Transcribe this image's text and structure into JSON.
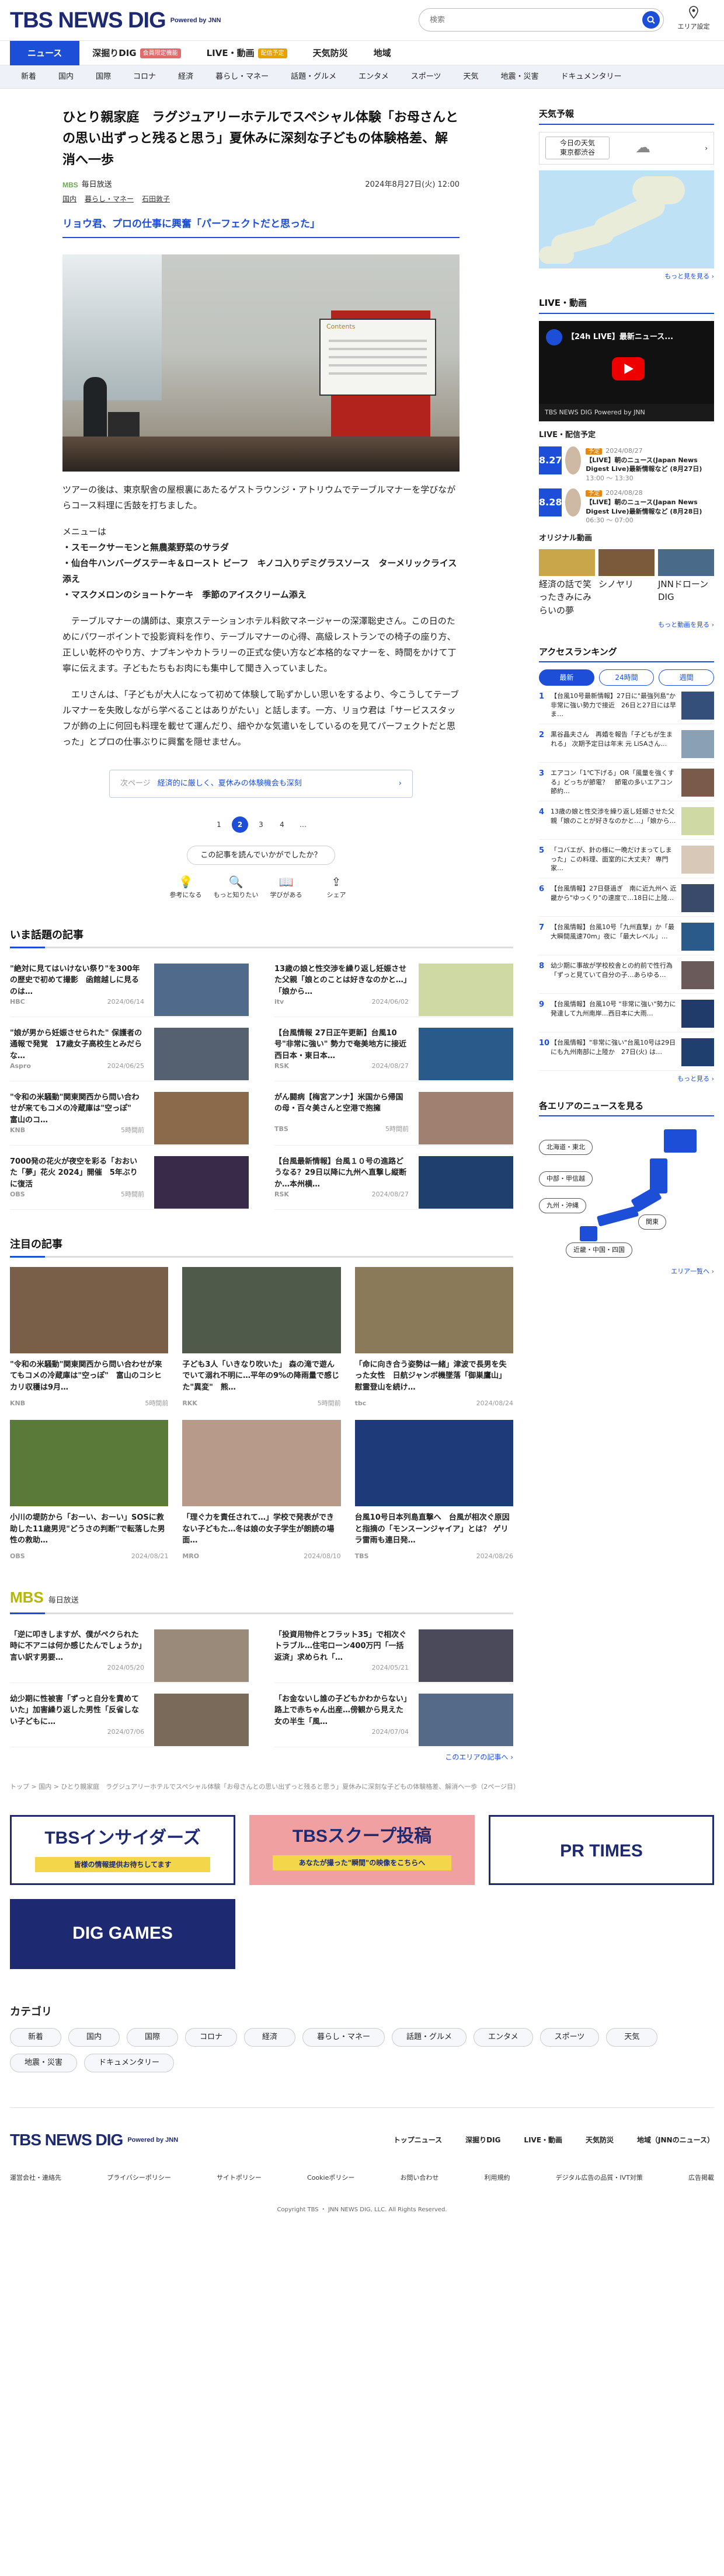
{
  "header": {
    "logo": "TBS NEWS DIG",
    "powered": "Powered by JNN",
    "search_placeholder": "検索",
    "area_setting": "エリア設定"
  },
  "nav_main": [
    {
      "label": "ニュース",
      "active": true
    },
    {
      "label": "深掘りDIG",
      "badge": "会員限定機能"
    },
    {
      "label": "LIVE・動画",
      "badge": "配信予定"
    },
    {
      "label": "天気防災"
    },
    {
      "label": "地域"
    }
  ],
  "nav_sub": [
    "新着",
    "国内",
    "国際",
    "コロナ",
    "経済",
    "暮らし・マネー",
    "話題・グルメ",
    "エンタメ",
    "スポーツ",
    "天気",
    "地震・災害",
    "ドキュメンタリー"
  ],
  "article": {
    "title": "ひとり親家庭　ラグジュアリーホテルでスペシャル体験「お母さんとの思い出ずっと残ると思う」夏休みに深刻な子どもの体験格差、解消へ一歩",
    "source": "毎日放送",
    "source_logo": "MBS",
    "date": "2024年8月27日(火) 12:00",
    "tags": [
      "国内",
      "暮らし・マネー",
      "石田敦子"
    ],
    "subheading": "リョウ君、プロの仕事に興奮「パーフェクトだと思った」",
    "slide_title": "Contents",
    "p1": "ツアーの後は、東京駅舎の屋根裏にあたるゲストラウンジ・アトリウムでテーブルマナーを学びながらコース料理に舌鼓を打ちました。",
    "menu_head": "メニューは",
    "menu": [
      "・スモークサーモンと無農薬野菜のサラダ",
      "・仙台牛ハンバーグステーキ＆ロースト ビーフ　キノコ入りデミグラスソース　ターメリックライス添え",
      "・マスクメロンのショートケーキ　季節のアイスクリーム添え"
    ],
    "p2": "　テーブルマナーの講師は、東京ステーションホテル料飲マネージャーの深澤聡史さん。この日のためにパワーポイントで投影資料を作り、テーブルマナーの心得、高級レストランでの椅子の座り方、正しい乾杯のやり方、ナプキンやカトラリーの正式な使い方など本格的なマナーを、時間をかけて丁寧に伝えます。子どもたちもお肉にも集中して聞き入っていました。",
    "p3": "　エリさんは、「子どもが大人になって初めて体験して恥ずかしい思いをするより、今こうしてテーブルマナーを失敗しながら学べることはありがたい」と話します。一方、リョウ君は「サービススタッフが飾の上に何回も料理を載せて運んだり、細やかな気遣いをしているのを見てパーフェクトだと思った」とプロの仕事ぶりに興奮を隠せません。",
    "related_label": "次ページ",
    "related_text": "経済的に厳しく、夏休みの体験機会も深刻",
    "pager": [
      "1",
      "2",
      "3",
      "4",
      "…"
    ],
    "pager_current": "2",
    "feedback_q": "この記事を読んでいかがでしたか？",
    "reactions": [
      "参考になる",
      "もっと知りたい",
      "学びがある",
      "シェア"
    ]
  },
  "hot": {
    "title": "いま話題の記事",
    "items": [
      {
        "text": "\"絶対に見てはいけない祭り\"を300年の歴史で初めて撮影　函館越しに見るのは…",
        "src": "HBC",
        "date": "2024/06/14",
        "c": "#4f6a8a"
      },
      {
        "text": "13歳の娘と性交渉を繰り返し妊娠させた父親「娘とのことは好きなのかと…」「娘から…",
        "src": "itv",
        "date": "2024/06/02",
        "c": "#cfd9a3"
      },
      {
        "text": "\"娘が男から妊娠させられた\" 保護者の通報で発覚　17歳女子高校生とみだらな…",
        "src": "Aspro",
        "date": "2024/06/25",
        "c": "#556070"
      },
      {
        "text": "【台風情報 27日正午更新】台風10号\"非常に強い\" 勢力で奄美地方に接近　西日本・東日本…",
        "src": "RSK",
        "date": "2024/08/27",
        "c": "#2a5a8a"
      },
      {
        "text": "\"令和の米騒動\"関東関西から問い合わせが来てもコメの冷蔵庫は\"空っぽ\"　富山のコ…",
        "src": "KNB",
        "date": "5時間前",
        "c": "#8a6a4a"
      },
      {
        "text": "がん闘病【梅宮アンナ】米国から帰国の母・百々美さんと空港で抱擁",
        "src": "TBS",
        "date": "5時間前",
        "c": "#a08070"
      },
      {
        "text": "7000発の花火が夜空を彩る「おおいた「夢」花火 2024」開催　5年ぶりに復活",
        "src": "OBS",
        "date": "5時間前",
        "c": "#3a2a4a"
      },
      {
        "text": "【台風最新情報】台風１０号の進路どうなる？29日以降に九州へ直撃し縦断か…本州横…",
        "src": "RSK",
        "date": "2024/08/27",
        "c": "#1f3f6f"
      }
    ]
  },
  "featured": {
    "title": "注目の記事",
    "items": [
      {
        "text": "\"令和の米騒動\"関東関西から問い合わせが来てもコメの冷蔵庫は\"空っぽ\"　富山のコシヒカリ収穫は9月…",
        "src": "KNB",
        "date": "5時間前",
        "c": "#7a5f48"
      },
      {
        "text": "子ども3人「いきなり吹いた」 森の滝で遊んでいて溺れ不明に…平年の9%の降雨量で感じた\"異変\"　熊…",
        "src": "RKK",
        "date": "5時間前",
        "c": "#505a4a"
      },
      {
        "text": "「命に向き合う姿勢は一緒」津波で長男を失った女性　日航ジャンボ機墜落「御巣鷹山」慰霊登山を続け…",
        "src": "tbc",
        "date": "2024/08/24",
        "c": "#8a7a5a"
      },
      {
        "text": "小川の堤防から「おーい、おーい」SOSに救助した11歳男児\"どうさの判断\"で転落した男性の救助…",
        "src": "OBS",
        "date": "2024/08/21",
        "c": "#5a7a3a"
      },
      {
        "text": "「理ぐ力を責任されて…」学校で発表ができない子どもた…冬は娘の女子学生が朗読の場面…",
        "src": "MRO",
        "date": "2024/08/10",
        "c": "#b79a8a"
      },
      {
        "text": "台風10号日本列島直撃へ　台風が相次ぐ原因と指摘の「モンスーンジャイア」とは？ ゲリラ雷雨も連日発…",
        "src": "TBS",
        "date": "2024/08/26",
        "c": "#1e3a78"
      }
    ]
  },
  "mbs": {
    "logo": "MBS",
    "label": "毎日放送",
    "items": [
      {
        "text": "「逆に叩きしますが、僕がペクられた時に不アニは何か感じたんでしょうか」言い訳す男要…",
        "date": "2024/05/20",
        "c": "#9a8a7a"
      },
      {
        "text": "「投資用物件とフラット35」で相次ぐトラブル…住宅ローン400万円「一括返済」求められ「…",
        "date": "2024/05/21",
        "c": "#4a4a5a"
      },
      {
        "text": "幼少期に性被害「ずっと自分を責めていた」加害繰り返した男性「反省しない子どもに…",
        "date": "2024/07/06",
        "c": "#7a6a5a"
      },
      {
        "text": "「お金ないし誰の子どもかわからない」路上で赤ちゃん出産…傍観から見えた女の半生「風…",
        "date": "2024/07/04",
        "c": "#556a88"
      }
    ],
    "more": "このエリアの記事へ ›"
  },
  "breadcrumb": "トップ > 国内 > ひとり親家庭　ラグジュアリーホテルでスペシャル体験「お母さんとの思い出ずっと残ると思う」夏休みに深刻な子どもの体験格差、解消へ一歩（2ページ目）",
  "side": {
    "weather_title": "天気予報",
    "weather_place": "今日の天気\n東京都渋谷",
    "weather_more": "もっと見を見る ›",
    "live_title": "LIVE・動画",
    "live_video": "【24h LIVE】最新ニュース...",
    "live_bar": "TBS NEWS DIG Powered by JNN",
    "live_sub": "LIVE・配信予定",
    "live_items": [
      {
        "badge": "予定",
        "day": "8.27",
        "sub": "火",
        "date": "2024/08/27",
        "text": "【LIVE】朝のニュース(Japan News Digest Live)最新情報など (8月27日)",
        "time": "13:00 ～ 13:30"
      },
      {
        "badge": "予定",
        "day": "8.28",
        "sub": "水",
        "date": "2024/08/28",
        "text": "【LIVE】朝のニュース(Japan News Digest Live)最新情報など (8月28日)",
        "time": "06:30 ～ 07:00"
      }
    ],
    "orig_title": "オリジナル動画",
    "origs": [
      "経済の話で笑ったきみにみらいの夢",
      "シノヤリ",
      "JNNドローンDIG"
    ],
    "orig_more": "もっと動画を見る ›",
    "rank_title": "アクセスランキング",
    "rank_tabs": [
      "最新",
      "24時間",
      "週間"
    ],
    "ranks": [
      "【台風10号最新情報】27日に\"最強列島\"か 非常に強い勢力で接近　26日と27日には早ま…",
      "黒谷晶夫さん　再婚を報告「子どもが生まれる」 次期予定日は年末 元 LiSAさん…",
      "エアコン「1℃下げる」OR「風量を強くする」どっちが節電？　節電の多いエアコン節約…",
      "13歳の娘と性交渉を繰り返し妊娠させた父親「娘のことが好きなのかと…」「娘から…",
      "「コバエが、針の様に一晩だけまってしまった」この料理、面室的に大丈夫？ 専門家…",
      "【台風情報】27日昼過ぎ　南に近九州へ 近畿から\"ゆっくり\"の速度で…18日に上陸…",
      "【台風情報】台風10号「九州直撃」か「最大瞬間風速70m」夜に「最大レベル」…",
      "幼少期に事故が学校校舎との約前で性行為「ずっと見ていて自分の子…あらゆる…",
      "【台風情報】台風10号 \"非常に強い\"勢力に発達して九州南岸…西日本に大雨…",
      "【台風情報】\"非常に強い\"台風10号は29日にも九州南部に上陸か　27日(火) は…"
    ],
    "rank_more": "もっと見る ›",
    "area_title": "各エリアのニュースを見る",
    "areas": [
      "北海道・東北",
      "中部・甲信越",
      "九州・沖縄",
      "関東",
      "近畿・中国・四国"
    ],
    "area_more": "エリア一覧へ ›"
  },
  "banners": [
    {
      "text": "TBSインサイダーズ",
      "sub": "皆様の情報提供お待ちしてます"
    },
    {
      "text": "TBSスクープ投稿",
      "sub": "あなたが撮った\"瞬間\"の映像をこちらへ"
    },
    {
      "text": "PR TIMES",
      "sub": ""
    },
    {
      "text": "DIG GAMES",
      "sub": ""
    }
  ],
  "categories_title": "カテゴリ",
  "categories": [
    "新着",
    "国内",
    "国際",
    "コロナ",
    "経済",
    "暮らし・マネー",
    "話題・グルメ",
    "エンタメ",
    "スポーツ",
    "天気",
    "地震・災害",
    "ドキュメンタリー"
  ],
  "footer": {
    "links": [
      "トップニュース",
      "深掘りDIG",
      "LIVE・動画",
      "天気防災",
      "地域（JNNのニュース）"
    ],
    "links2": [
      "運営会社・連絡先",
      "プライバシーポリシー",
      "サイトポリシー",
      "Cookieポリシー",
      "お問い合わせ",
      "利用規約",
      "デジタル広告の品質・IVT対策",
      "広告掲載"
    ],
    "copyright": "Copyright TBS ・ JNN NEWS DIG, LLC. All Rights Reserved."
  },
  "colors": {
    "brand": "#1d4ed8",
    "navy": "#1d2a72",
    "accent": "#e26a6a"
  }
}
